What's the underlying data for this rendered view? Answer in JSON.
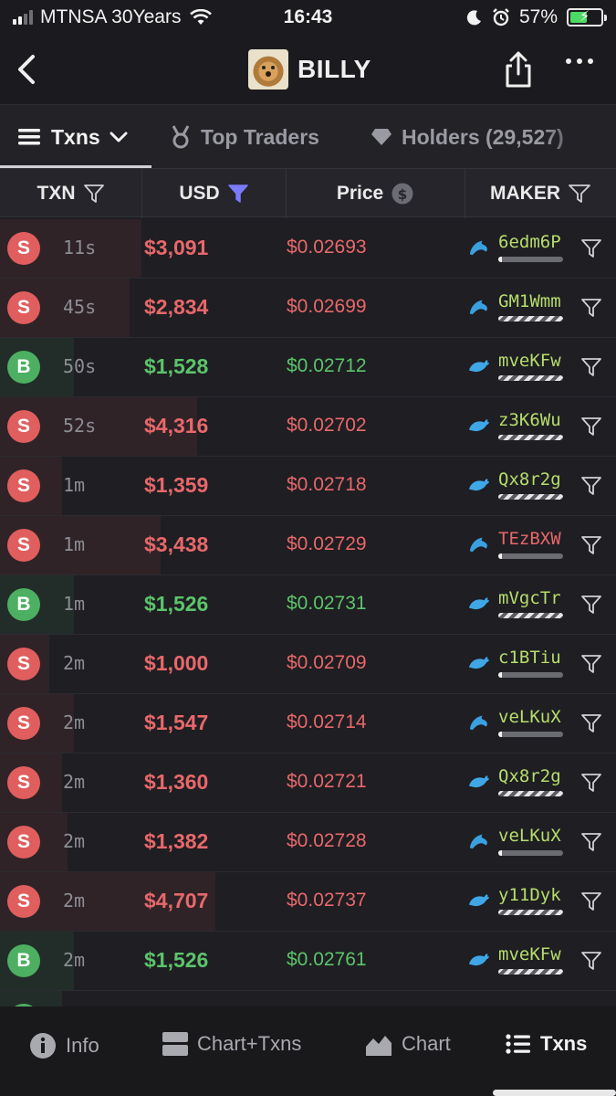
{
  "status_bar": {
    "carrier": "MTNSA 30Years",
    "time": "16:43",
    "battery_percent": "57%",
    "battery_level": 0.57
  },
  "header": {
    "title": "BILLY"
  },
  "tabs": [
    {
      "label": "Txns",
      "active": true,
      "icon": "list-icon"
    },
    {
      "label": "Top Traders",
      "active": false,
      "icon": "medal-icon"
    },
    {
      "label": "Holders (29,527)",
      "active": false,
      "icon": "diamond-icon"
    }
  ],
  "columns": {
    "txn": "TXN",
    "usd": "USD",
    "price": "Price",
    "maker": "MAKER"
  },
  "colors": {
    "buy": "#5cc46a",
    "sell": "#e8686a",
    "accent_filter": "#7b7bff",
    "whale_icon": "#3fa7e6",
    "dolphin_icon": "#3aa0e0"
  },
  "rows": [
    {
      "type": "S",
      "age": "11s",
      "usd": "$3,091",
      "price": "$0.02693",
      "maker": "6edm6P",
      "maker_icon": "dolphin-icon",
      "maker_color": "green",
      "bar_style": "solid",
      "volume_share": 0.23
    },
    {
      "type": "S",
      "age": "45s",
      "usd": "$2,834",
      "price": "$0.02699",
      "maker": "GM1Wmm",
      "maker_icon": "dolphin-icon",
      "maker_color": "green",
      "bar_style": "striped",
      "volume_share": 0.21
    },
    {
      "type": "B",
      "age": "50s",
      "usd": "$1,528",
      "price": "$0.02712",
      "maker": "mveKFw",
      "maker_icon": "whale-icon",
      "maker_color": "green",
      "bar_style": "striped",
      "volume_share": 0.12
    },
    {
      "type": "S",
      "age": "52s",
      "usd": "$4,316",
      "price": "$0.02702",
      "maker": "z3K6Wu",
      "maker_icon": "whale-icon",
      "maker_color": "green",
      "bar_style": "striped",
      "volume_share": 0.32
    },
    {
      "type": "S",
      "age": "1m",
      "usd": "$1,359",
      "price": "$0.02718",
      "maker": "Qx8r2g",
      "maker_icon": "whale-icon",
      "maker_color": "green",
      "bar_style": "striped",
      "volume_share": 0.1
    },
    {
      "type": "S",
      "age": "1m",
      "usd": "$3,438",
      "price": "$0.02729",
      "maker": "TEzBXW",
      "maker_icon": "dolphin-icon",
      "maker_color": "red",
      "bar_style": "solid",
      "volume_share": 0.26
    },
    {
      "type": "B",
      "age": "1m",
      "usd": "$1,526",
      "price": "$0.02731",
      "maker": "mVgcTr",
      "maker_icon": "whale-icon",
      "maker_color": "green",
      "bar_style": "striped",
      "volume_share": 0.12
    },
    {
      "type": "S",
      "age": "2m",
      "usd": "$1,000",
      "price": "$0.02709",
      "maker": "c1BTiu",
      "maker_icon": "whale-icon",
      "maker_color": "green",
      "bar_style": "solid",
      "volume_share": 0.08
    },
    {
      "type": "S",
      "age": "2m",
      "usd": "$1,547",
      "price": "$0.02714",
      "maker": "veLKuX",
      "maker_icon": "dolphin-icon",
      "maker_color": "green",
      "bar_style": "solid",
      "volume_share": 0.12
    },
    {
      "type": "S",
      "age": "2m",
      "usd": "$1,360",
      "price": "$0.02721",
      "maker": "Qx8r2g",
      "maker_icon": "whale-icon",
      "maker_color": "green",
      "bar_style": "striped",
      "volume_share": 0.1
    },
    {
      "type": "S",
      "age": "2m",
      "usd": "$1,382",
      "price": "$0.02728",
      "maker": "veLKuX",
      "maker_icon": "dolphin-icon",
      "maker_color": "green",
      "bar_style": "solid",
      "volume_share": 0.11
    },
    {
      "type": "S",
      "age": "2m",
      "usd": "$4,707",
      "price": "$0.02737",
      "maker": "y11Dyk",
      "maker_icon": "whale-icon",
      "maker_color": "green",
      "bar_style": "striped",
      "volume_share": 0.35
    },
    {
      "type": "B",
      "age": "2m",
      "usd": "$1,526",
      "price": "$0.02761",
      "maker": "mveKFw",
      "maker_icon": "whale-icon",
      "maker_color": "green",
      "bar_style": "striped",
      "volume_share": 0.12
    },
    {
      "type": "B",
      "age": "",
      "usd": "",
      "price": "",
      "maker": "",
      "maker_icon": "",
      "maker_color": "green",
      "bar_style": "solid",
      "volume_share": 0.1
    }
  ],
  "bottom_nav": [
    {
      "label": "Info",
      "icon": "info-icon",
      "active": false
    },
    {
      "label": "Chart+Txns",
      "icon": "split-view-icon",
      "active": false
    },
    {
      "label": "Chart",
      "icon": "area-chart-icon",
      "active": false
    },
    {
      "label": "Txns",
      "icon": "list-icon",
      "active": true
    }
  ]
}
